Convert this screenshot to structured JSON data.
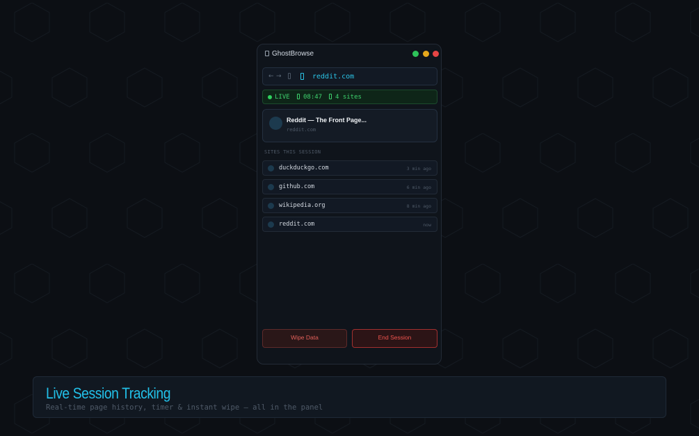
{
  "window": {
    "title": "GhostBrowse",
    "icon": "phone-icon",
    "controls": [
      {
        "name": "green-dot",
        "color": "#2ec35a"
      },
      {
        "name": "yellow-dot",
        "color": "#e6a81c"
      },
      {
        "name": "red-dot",
        "color": "#e64545"
      }
    ]
  },
  "urlbar": {
    "back": "←",
    "forward": "→",
    "url": "reddit.com"
  },
  "status": {
    "live": "LIVE",
    "timer": "08:47",
    "sites": "4 sites"
  },
  "current": {
    "title": "Reddit — The Front Page...",
    "url": "reddit.com"
  },
  "history": {
    "label": "SITES THIS SESSION",
    "items": [
      {
        "site": "duckduckgo.com",
        "time": "3 min ago"
      },
      {
        "site": "github.com",
        "time": "6 min ago"
      },
      {
        "site": "wikipedia.org",
        "time": "8 min ago"
      },
      {
        "site": "reddit.com",
        "time": "now"
      }
    ]
  },
  "actions": {
    "wipe": "Wipe Data",
    "end": "End Session"
  },
  "banner": {
    "title": "Live Session Tracking",
    "subtitle": "Real-time page history, timer & instant wipe — all in the panel"
  },
  "colors": {
    "accent": "#22c0e8",
    "live": "#3ed26e",
    "danger": "#f0544e"
  }
}
